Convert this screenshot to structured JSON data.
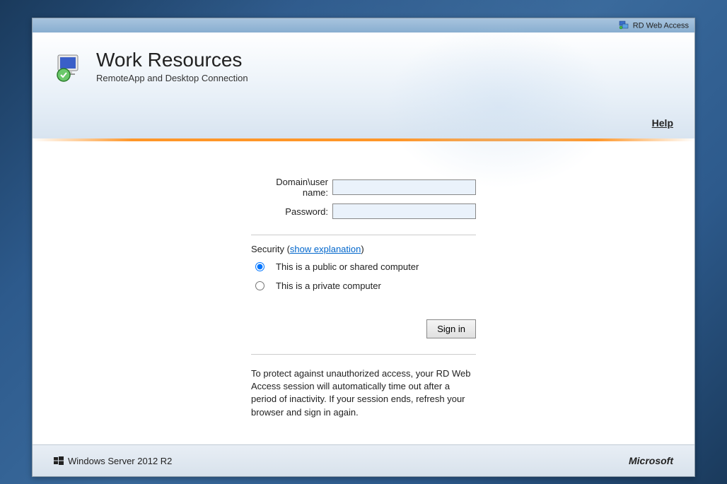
{
  "topbar": {
    "label": "RD Web Access"
  },
  "header": {
    "title": "Work Resources",
    "subtitle": "RemoteApp and Desktop Connection",
    "help": "Help"
  },
  "form": {
    "username_label": "Domain\\user name:",
    "username_value": "",
    "password_label": "Password:",
    "password_value": "",
    "security_prefix": "Security (",
    "security_link": "show explanation",
    "security_suffix": ")",
    "radio_public": "This is a public or shared computer",
    "radio_private": "This is a private computer",
    "signin_label": "Sign in",
    "protect_text": "To protect against unauthorized access, your RD Web Access session will automatically time out after a period of inactivity. If your session ends, refresh your browser and sign in again."
  },
  "footer": {
    "windows_server": "Windows Server 2012 R2",
    "microsoft": "Microsoft"
  }
}
